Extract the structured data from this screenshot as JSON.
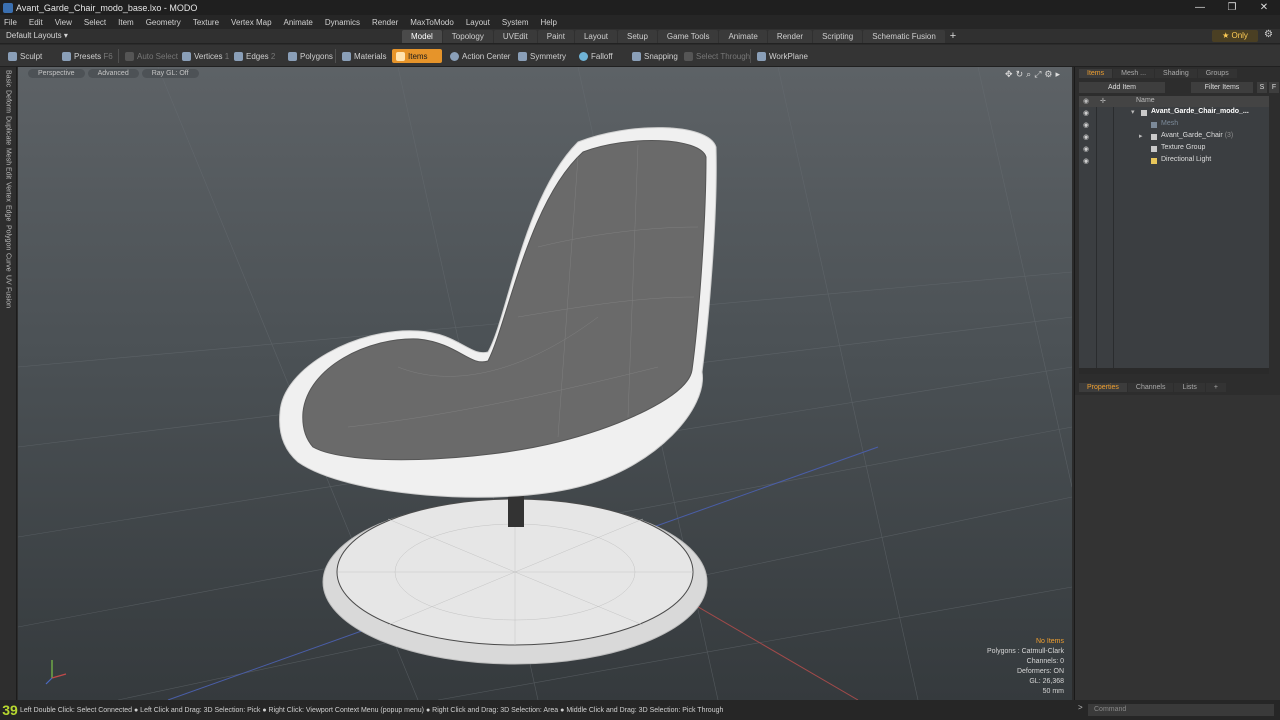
{
  "window": {
    "title": "Avant_Garde_Chair_modo_base.lxo - MODO",
    "controls": [
      "—",
      "❐",
      "✕"
    ]
  },
  "menu": [
    "File",
    "Edit",
    "View",
    "Select",
    "Item",
    "Geometry",
    "Texture",
    "Vertex Map",
    "Animate",
    "Dynamics",
    "Render",
    "MaxToModo",
    "Layout",
    "System",
    "Help"
  ],
  "layout": {
    "default_layouts": "Default Layouts ▾",
    "tabs": [
      "Model",
      "Topology",
      "UVEdit",
      "Paint",
      "Layout",
      "Setup",
      "Game Tools",
      "Animate",
      "Render",
      "Scripting",
      "Schematic Fusion"
    ],
    "active_tab": "Model",
    "only_label": "★ Only"
  },
  "toolbar": {
    "sculpt": "Sculpt",
    "presets": "Presets",
    "presets_key": "F6",
    "auto_select": "Auto Select",
    "vertices": "Vertices",
    "vertices_key": "1",
    "edges": "Edges",
    "edges_key": "2",
    "polygons": "Polygons",
    "materials": "Materials",
    "items": "Items",
    "action_center": "Action Center",
    "symmetry": "Symmetry",
    "falloff": "Falloff",
    "snapping": "Snapping",
    "select_through": "Select Through",
    "workplane": "WorkPlane"
  },
  "left_tabs": [
    "Basic",
    "Deform",
    "Duplicate",
    "Mesh Edit",
    "Vertex",
    "Edge",
    "Polygon",
    "Curve",
    "UV",
    "Fusion"
  ],
  "viewport": {
    "buttons": [
      "Perspective",
      "Advanced",
      "Ray GL: Off"
    ],
    "info": {
      "selection": "No Items",
      "polygons": "Polygons : Catmull-Clark",
      "channels": "Channels: 0",
      "deformers": "Deformers: ON",
      "gl": "GL: 26,368",
      "scale": "50 mm"
    }
  },
  "status": {
    "fps": "39",
    "message": "Left Double Click: Select Connected ● Left Click and Drag: 3D Selection: Pick ● Right Click: Viewport Context Menu (popup menu) ● Right Click and Drag: 3D Selection: Area ● Middle Click and Drag: 3D Selection: Pick Through"
  },
  "items_panel": {
    "tabs": [
      "Items",
      "Mesh ...",
      "Shading",
      "Groups"
    ],
    "active": "Items",
    "add_item": "Add Item",
    "filter_items": "Filter Items",
    "s_btn": "S",
    "f_btn": "F",
    "name_header": "Name",
    "rows": [
      {
        "label": "Avant_Garde_Chair_modo_...",
        "count": ""
      },
      {
        "label": "Mesh",
        "count": ""
      },
      {
        "label": "Avant_Garde_Chair",
        "count": "(3)"
      },
      {
        "label": "Texture Group",
        "count": ""
      },
      {
        "label": "Directional Light",
        "count": ""
      }
    ]
  },
  "props_panel": {
    "tabs": [
      "Properties",
      "Channels",
      "Lists",
      "+"
    ],
    "active": "Properties"
  },
  "command": {
    "placeholder": "Command"
  }
}
